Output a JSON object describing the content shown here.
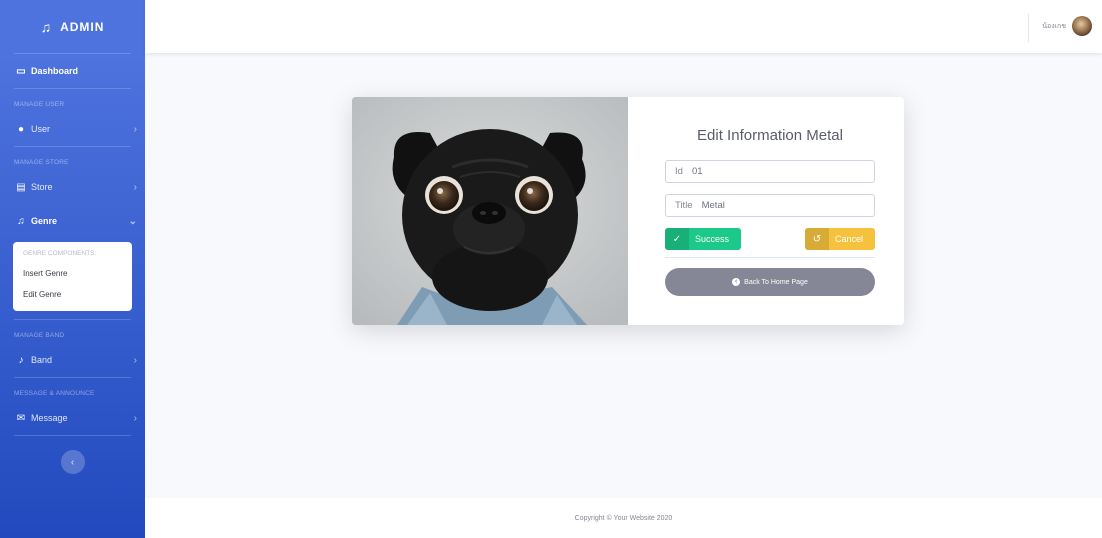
{
  "sidebar": {
    "brand": "ADMIN",
    "brand_icon": "music-note-icon",
    "dashboard": "Dashboard",
    "heading_user": "MANAGE USER",
    "user": "User",
    "heading_store": "MANAGE STORE",
    "store": "Store",
    "genre": "Genre",
    "genre_submenu": {
      "header": "GENRE COMPONENTS:",
      "items": [
        "Insert Genre",
        "Edit Genre"
      ]
    },
    "heading_band": "MANAGE BAND",
    "band": "Band",
    "heading_message": "MESSAGE & ANNOUNCE",
    "message": "Message"
  },
  "topbar": {
    "username": "น้องเกช"
  },
  "card": {
    "title": "Edit Information Metal",
    "id_label": "Id",
    "id_value": "01",
    "title_label": "Title",
    "title_value": "Metal",
    "success_label": "Success",
    "cancel_label": "Cancel",
    "home_label": "Back To Home Page"
  },
  "footer": {
    "copyright": "Copyright © Your Website 2020"
  },
  "colors": {
    "sidebar_start": "#4e73df",
    "sidebar_end": "#224abe",
    "success": "#1cc88a",
    "warning": "#f6c23e",
    "secondary": "#858796"
  }
}
